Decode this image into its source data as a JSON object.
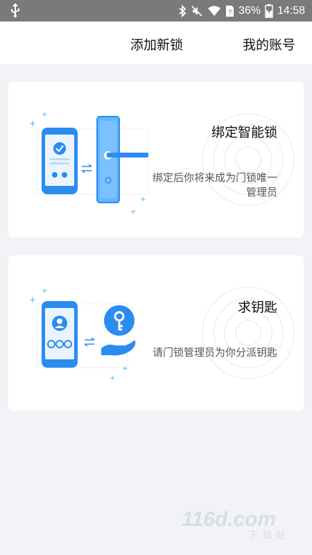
{
  "status_bar": {
    "battery_percent": "36%",
    "time": "14:58",
    "icons": [
      "usb-icon",
      "bluetooth-icon",
      "mute-icon",
      "wifi-icon",
      "sim-icon",
      "battery-icon"
    ]
  },
  "header": {
    "add_lock_label": "添加新锁",
    "my_account_label": "我的账号"
  },
  "cards": [
    {
      "title": "绑定智能锁",
      "description": "绑定后你将来成为门锁唯一管理员",
      "icon": "phone-lock-illustration"
    },
    {
      "title": "求钥匙",
      "description": "请门锁管理员为你分派钥匙",
      "icon": "phone-key-illustration"
    }
  ],
  "watermark": {
    "text": "116d.com",
    "subtext": "下载站"
  },
  "colors": {
    "accent": "#2b8cf0",
    "background": "#f2f3f6",
    "status_bar": "#7a7a7a"
  }
}
